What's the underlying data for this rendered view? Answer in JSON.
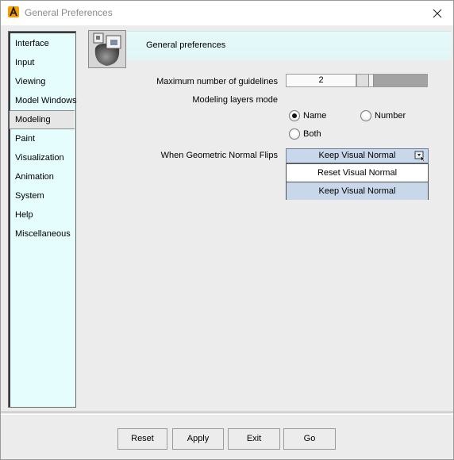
{
  "window": {
    "title": "General Preferences"
  },
  "sidebar": {
    "items": [
      {
        "label": "Interface"
      },
      {
        "label": "Input"
      },
      {
        "label": "Viewing"
      },
      {
        "label": "Model Windows"
      },
      {
        "label": "Modeling",
        "selected": true
      },
      {
        "label": "Paint"
      },
      {
        "label": "Visualization"
      },
      {
        "label": "Animation"
      },
      {
        "label": "System"
      },
      {
        "label": "Help"
      },
      {
        "label": "Miscellaneous"
      }
    ]
  },
  "header": {
    "title": "General preferences"
  },
  "form": {
    "guidelines_label": "Maximum number of guidelines",
    "guidelines_value": "2",
    "layers_mode_label": "Modeling layers mode",
    "layers_options": [
      {
        "label": "Name",
        "selected": true
      },
      {
        "label": "Number",
        "selected": false
      },
      {
        "label": "Both",
        "selected": false
      }
    ],
    "normal_flip_label": "When Geometric Normal Flips",
    "normal_flip_value": "Keep Visual Normal",
    "normal_flip_options": [
      "Reset Visual Normal",
      "Keep Visual Normal"
    ]
  },
  "buttons": {
    "reset": "Reset",
    "apply": "Apply",
    "exit": "Exit",
    "go": "Go"
  },
  "icons": {
    "app": "app-logo-icon",
    "close": "close-icon",
    "header": "modeling-preferences-icon",
    "dropdown": "dropdown-arrow-icon"
  },
  "colors": {
    "accent_selection": "#c9d7ea",
    "sidebar_bg": "#e5fdfd",
    "logo": "#f59e00"
  }
}
